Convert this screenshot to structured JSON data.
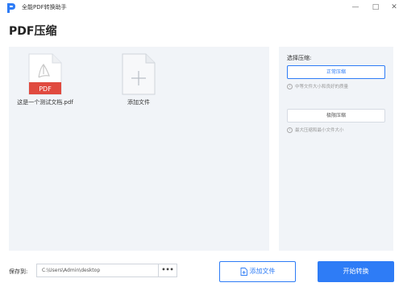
{
  "app": {
    "title": "全能PDF转换助手",
    "logo_icon": "app-logo-icon",
    "brand_color": "#2e7cf6"
  },
  "window_controls": {
    "minimize": "—",
    "maximize": "□",
    "close": "✕"
  },
  "page": {
    "title": "PDF压缩"
  },
  "files": {
    "items": [
      {
        "name": "这是一个测试文档.pdf",
        "badge": "PDF",
        "icon": "pdf-file-icon"
      }
    ],
    "add_tile": {
      "label": "添加文件",
      "icon": "add-file-plus-icon"
    }
  },
  "compression": {
    "title": "选择压缩:",
    "selected": "正常压缩",
    "modes": [
      {
        "label": "正常压缩",
        "description": "中等文件大小和良好的质量"
      },
      {
        "label": "极限压缩",
        "description": "最大压缩和最小文件大小"
      }
    ],
    "info_icon": "i"
  },
  "save": {
    "label": "保存到:",
    "path": "C:\\Users\\Admin\\desktop",
    "browse_label": "•••"
  },
  "actions": {
    "add_file": "添加文件",
    "start": "开始转换"
  }
}
